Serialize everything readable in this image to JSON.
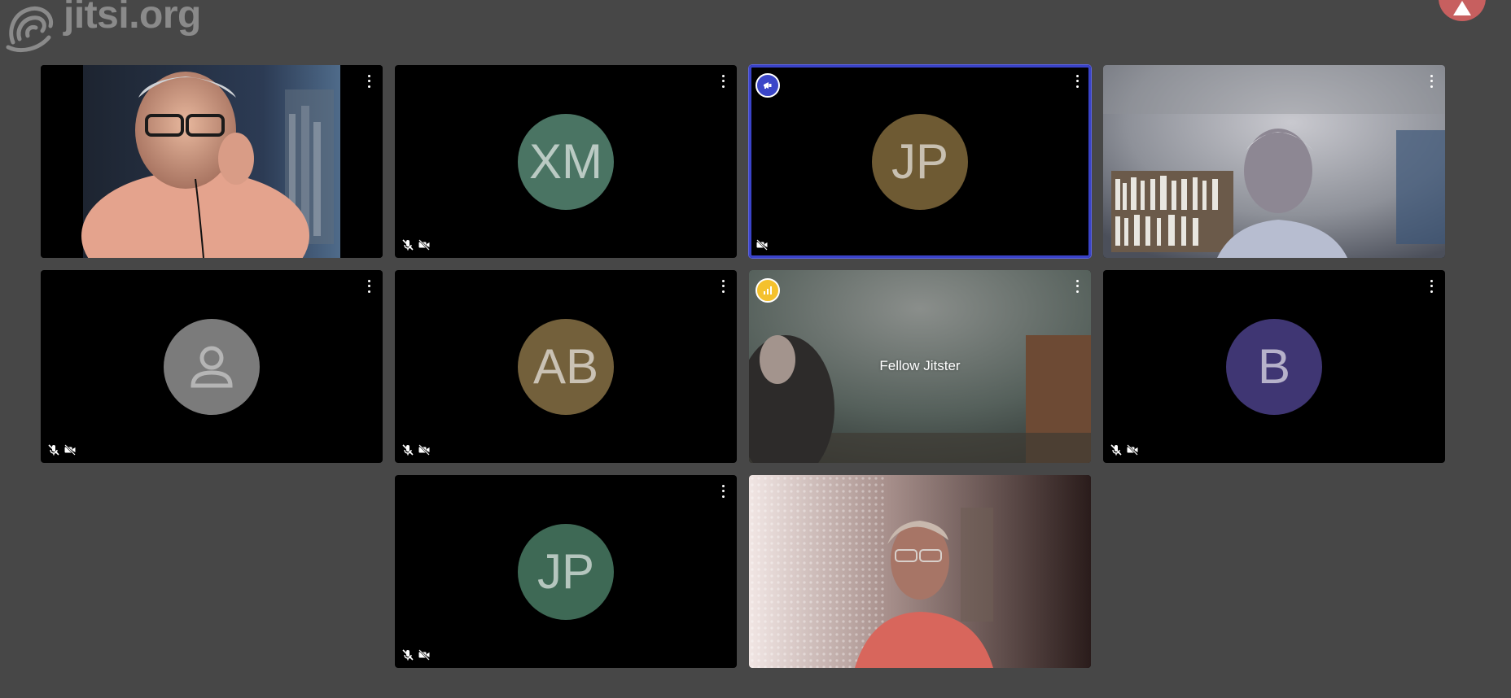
{
  "branding": {
    "logo_text": "jitsi.org"
  },
  "participants": [
    {
      "id": "p1",
      "type": "video",
      "video_desc": "man-headset"
    },
    {
      "id": "p2",
      "type": "avatar",
      "initials": "XM",
      "avatar_color": "#4a7463",
      "audio_muted": true,
      "video_muted": true
    },
    {
      "id": "p3",
      "type": "avatar",
      "initials": "JP",
      "avatar_color": "#6e5a33",
      "audio_muted": false,
      "video_muted": true,
      "active_speaker": true,
      "top_badge": "raised-hand-icon"
    },
    {
      "id": "p4",
      "type": "video",
      "video_desc": "man-bookshelf"
    },
    {
      "id": "p5",
      "type": "avatar",
      "initials": "",
      "avatar_color": "#7b7b7b",
      "avatar_icon": "user-icon",
      "audio_muted": true,
      "video_muted": true
    },
    {
      "id": "p6",
      "type": "avatar",
      "initials": "AB",
      "avatar_color": "#73603b",
      "audio_muted": true,
      "video_muted": true
    },
    {
      "id": "p7",
      "type": "video",
      "video_desc": "room-green",
      "display_name": "Fellow Jitster",
      "top_badge": "connection-quality-icon"
    },
    {
      "id": "p8",
      "type": "avatar",
      "initials": "B",
      "avatar_color": "#3f3673",
      "audio_muted": true,
      "video_muted": true
    },
    {
      "id": "p9",
      "type": "avatar",
      "initials": "JP",
      "avatar_color": "#3e6955",
      "audio_muted": true,
      "video_muted": true
    },
    {
      "id": "p10",
      "type": "video",
      "video_desc": "woman-curtain"
    }
  ],
  "colors": {
    "background": "#474747",
    "active_border": "#3a43c9",
    "raised_hand_badge": "#3b46c8",
    "connection_badge": "#f4c12d"
  }
}
